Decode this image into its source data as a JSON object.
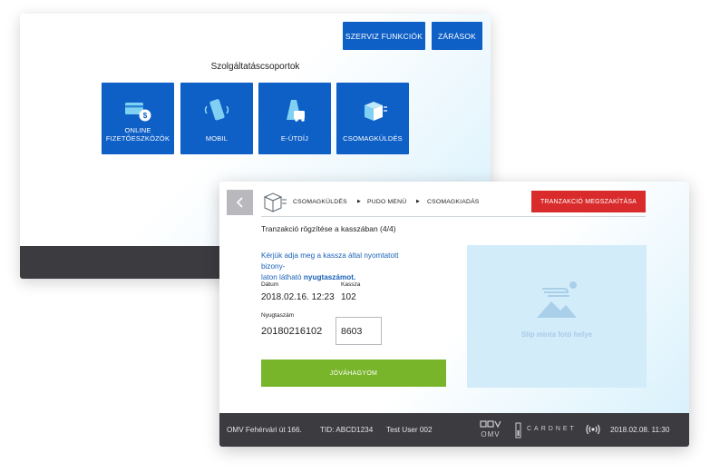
{
  "back_screen": {
    "top_buttons": [
      "SZERVIZ FUNKCIÓK",
      "ZÁRÁSOK"
    ],
    "title": "Szolgáltatáscsoportok",
    "tiles": [
      {
        "label": "ONLINE FIZETŐESZKÖZÖK",
        "icon": "card-coin-icon"
      },
      {
        "label": "MOBIL",
        "icon": "mobile-icon"
      },
      {
        "label": "E-ÚTDÍJ",
        "icon": "road-toll-icon"
      },
      {
        "label": "CSOMAGKÜLDÉS",
        "icon": "package-icon"
      }
    ]
  },
  "front_screen": {
    "breadcrumb": [
      "CSOMAGKÜLDÉS",
      "PUDO MENÜ",
      "CSOMAGKIADÁS"
    ],
    "cancel_label": "TRANZAKCIÓ MEGSZAKÍTÁSA",
    "heading": "Tranzakció rögzítése a kasszában",
    "heading_step": "(4/4)",
    "instruction_line1": "Kérjük adja meg a kassza által nyomtatott bizony-",
    "instruction_line2": "laton látható",
    "instruction_bold": "nyugtaszámot.",
    "date_label": "Dátum",
    "date_value": "2018.02.16. 12:23",
    "till_label": "Kassza",
    "till_value": "102",
    "receipt_label": "Nyugtaszám",
    "receipt_value": "20180216102",
    "code_value": "8603",
    "confirm_label": "JÓVÁHAGYOM",
    "slip_placeholder": "Slip minta fotó helye",
    "footer": {
      "address": "OMV Fehérvári út 166.",
      "tid": "TID: ABCD1234",
      "user": "Test User 002",
      "brand_omv": "OMV",
      "brand_cardnet": "CARDNET",
      "datetime": "2018.02.08. 11:30"
    }
  },
  "colors": {
    "primary_blue": "#0e5fc6",
    "danger_red": "#d92b2b",
    "confirm_green": "#78b52b",
    "footer_dark": "#3b3b40"
  }
}
